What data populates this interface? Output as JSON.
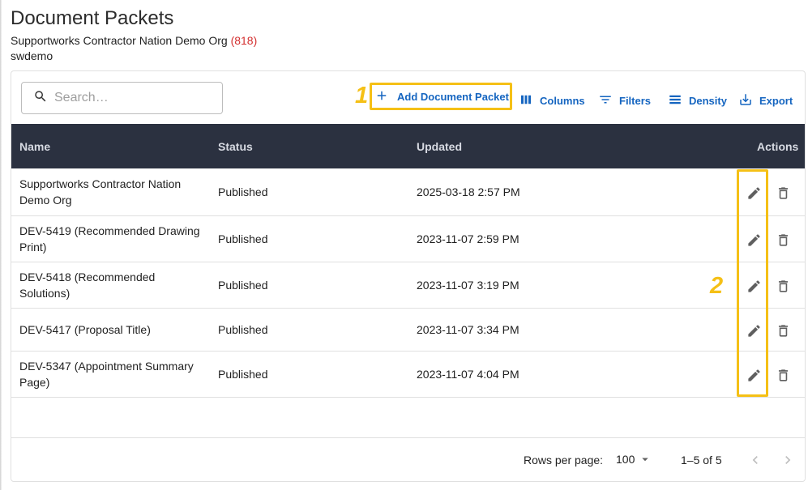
{
  "header": {
    "title": "Document Packets",
    "org_name": "Supportworks Contractor Nation Demo Org",
    "org_count": "(818)",
    "username": "swdemo"
  },
  "toolbar": {
    "search_placeholder": "Search…",
    "annotation_1": "1",
    "add_label": "Add Document Packet",
    "columns_label": "Columns",
    "filters_label": "Filters",
    "density_label": "Density",
    "export_label": "Export"
  },
  "table": {
    "headers": {
      "name": "Name",
      "status": "Status",
      "updated": "Updated",
      "actions": "Actions"
    },
    "rows": [
      {
        "name": "Supportworks Contractor Nation Demo Org",
        "status": "Published",
        "updated": "2025-03-18 2:57 PM"
      },
      {
        "name": "DEV-5419 (Recommended Drawing Print)",
        "status": "Published",
        "updated": "2023-11-07 2:59 PM"
      },
      {
        "name": "DEV-5418 (Recommended Solutions)",
        "status": "Published",
        "updated": "2023-11-07 3:19 PM"
      },
      {
        "name": "DEV-5417 (Proposal Title)",
        "status": "Published",
        "updated": "2023-11-07 3:34 PM"
      },
      {
        "name": "DEV-5347 (Appointment Summary Page)",
        "status": "Published",
        "updated": "2023-11-07 4:04 PM"
      }
    ],
    "annotation_2": "2"
  },
  "footer": {
    "rows_per_page_label": "Rows per page:",
    "rows_per_page_value": "100",
    "range": "1–5 of 5"
  },
  "colors": {
    "accent": "#1565c0",
    "header_bg": "#2b3140",
    "annotation": "#f5c016",
    "org_count": "#d32f2f"
  },
  "icons": {
    "search": "search-icon",
    "add": "plus-icon",
    "columns": "columns-icon",
    "filters": "filter-icon",
    "density": "density-icon",
    "export": "export-icon",
    "edit": "pencil-icon",
    "delete": "trash-icon",
    "dropdown": "caret-down-icon",
    "prev": "chevron-left-icon",
    "next": "chevron-right-icon"
  }
}
